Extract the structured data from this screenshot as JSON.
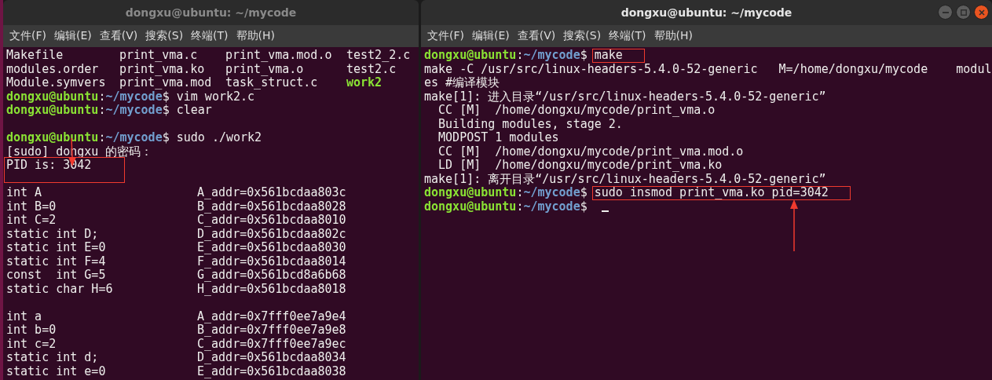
{
  "windows": [
    {
      "title": "dongxu@ubuntu: ~/mycode",
      "focused": false,
      "menu": [
        "文件(F)",
        "编辑(E)",
        "查看(V)",
        "搜索(S)",
        "终端(T)",
        "帮助(H)"
      ],
      "lines": [
        {
          "kind": "ls",
          "cells": [
            {
              "text": "Makefile",
              "executable": false
            },
            {
              "text": "print_vma.c",
              "executable": false
            },
            {
              "text": "print_vma.mod.o",
              "executable": false
            },
            {
              "text": "test2_2.c",
              "executable": false
            }
          ]
        },
        {
          "kind": "ls",
          "cells": [
            {
              "text": "modules.order",
              "executable": false
            },
            {
              "text": "print_vma.ko",
              "executable": false
            },
            {
              "text": "print_vma.o",
              "executable": false
            },
            {
              "text": "test2.c",
              "executable": false
            }
          ]
        },
        {
          "kind": "ls",
          "cells": [
            {
              "text": "Module.symvers",
              "executable": false
            },
            {
              "text": "print_vma.mod",
              "executable": false
            },
            {
              "text": "task_struct.c",
              "executable": false
            },
            {
              "text": "work2",
              "executable": true
            }
          ]
        },
        {
          "kind": "prompt",
          "user": "dongxu@ubuntu",
          "colon": ":",
          "path": "~/mycode",
          "dollar": "$",
          "command": "vim work2.c"
        },
        {
          "kind": "prompt",
          "user": "dongxu@ubuntu",
          "colon": ":",
          "path": "~/mycode",
          "dollar": "$",
          "command": "clear"
        },
        {
          "kind": "blank"
        },
        {
          "kind": "prompt",
          "user": "dongxu@ubuntu",
          "colon": ":",
          "path": "~/mycode",
          "dollar": "$",
          "command": "sudo ./work2"
        },
        {
          "kind": "text",
          "text": "[sudo] dongxu 的密码："
        },
        {
          "kind": "text",
          "text": "PID is: 3042",
          "highlighted": true
        },
        {
          "kind": "blank"
        },
        {
          "kind": "pair",
          "cells": [
            "int A",
            "A_addr=0x561bcdaa803c"
          ]
        },
        {
          "kind": "pair",
          "cells": [
            "int B=0",
            "B_addr=0x561bcdaa8028"
          ]
        },
        {
          "kind": "pair",
          "cells": [
            "int C=2",
            "C_addr=0x561bcdaa8010"
          ]
        },
        {
          "kind": "pair",
          "cells": [
            "static int D;",
            "D_addr=0x561bcdaa802c"
          ]
        },
        {
          "kind": "pair",
          "cells": [
            "static int E=0",
            "E_addr=0x561bcdaa8030"
          ]
        },
        {
          "kind": "pair",
          "cells": [
            "static int F=4",
            "F_addr=0x561bcdaa8014"
          ]
        },
        {
          "kind": "pair",
          "cells": [
            "const  int G=5",
            "G_addr=0x561bcd8a6b68"
          ]
        },
        {
          "kind": "pair",
          "cells": [
            "static char H=6",
            "H_addr=0x561bcdaa8018"
          ]
        },
        {
          "kind": "blank"
        },
        {
          "kind": "pair",
          "cells": [
            "int a",
            "A_addr=0x7fff0ee7a9e4"
          ]
        },
        {
          "kind": "pair",
          "cells": [
            "int b=0",
            "B_addr=0x7fff0ee7a9e8"
          ]
        },
        {
          "kind": "pair",
          "cells": [
            "int c=2",
            "C_addr=0x7fff0ee7a9ec"
          ]
        },
        {
          "kind": "pair",
          "cells": [
            "static int d;",
            "D_addr=0x561bcdaa8034"
          ]
        },
        {
          "kind": "pair",
          "cells": [
            "static int e=0",
            "E_addr=0x561bcdaa8038"
          ]
        }
      ],
      "arrows": [
        {
          "kind": "down"
        }
      ]
    },
    {
      "title": "dongxu@ubuntu: ~/mycode",
      "focused": true,
      "menu": [
        "文件(F)",
        "编辑(E)",
        "查看(V)",
        "搜索(S)",
        "终端(T)",
        "帮助(H)"
      ],
      "lines": [
        {
          "kind": "prompt",
          "user": "dongxu@ubuntu",
          "colon": ":",
          "path": "~/mycode",
          "dollar": "$",
          "command": "make",
          "highlighted": true
        },
        {
          "kind": "text",
          "text": "make -C /usr/src/linux-headers-5.4.0-52-generic   M=/home/dongxu/mycode    modul"
        },
        {
          "kind": "text",
          "text": "es #编译模块"
        },
        {
          "kind": "text",
          "text": "make[1]: 进入目录“/usr/src/linux-headers-5.4.0-52-generic”"
        },
        {
          "kind": "text",
          "text": "  CC [M]  /home/dongxu/mycode/print_vma.o"
        },
        {
          "kind": "text",
          "text": "  Building modules, stage 2."
        },
        {
          "kind": "text",
          "text": "  MODPOST 1 modules"
        },
        {
          "kind": "text",
          "text": "  CC [M]  /home/dongxu/mycode/print_vma.mod.o"
        },
        {
          "kind": "text",
          "text": "  LD [M]  /home/dongxu/mycode/print_vma.ko"
        },
        {
          "kind": "text",
          "text": "make[1]: 离开目录“/usr/src/linux-headers-5.4.0-52-generic”"
        },
        {
          "kind": "prompt",
          "user": "dongxu@ubuntu",
          "colon": ":",
          "path": "~/mycode",
          "dollar": "$",
          "command": "sudo insmod print_vma.ko pid=3042",
          "highlighted": true
        },
        {
          "kind": "prompt",
          "user": "dongxu@ubuntu",
          "colon": ":",
          "path": "~/mycode",
          "dollar": "$",
          "cursor": true
        }
      ],
      "arrows": [
        {
          "kind": "up"
        }
      ]
    }
  ]
}
